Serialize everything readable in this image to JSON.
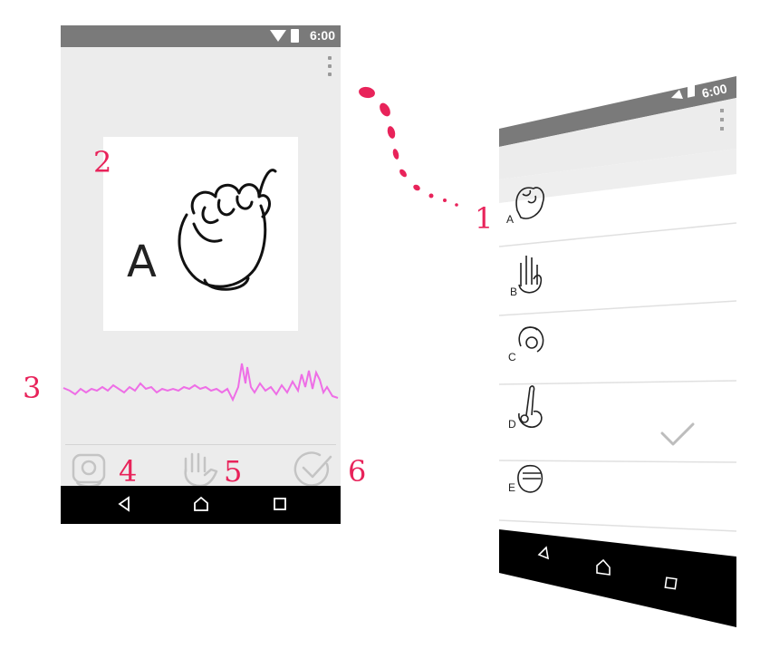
{
  "status": {
    "time": "6:00"
  },
  "detail": {
    "sign_letter": "A"
  },
  "callouts": [
    "1",
    "2",
    "3",
    "4",
    "5",
    "6"
  ],
  "list_phone": {
    "status_time": "6:00",
    "items": [
      {
        "letter": "A",
        "checked": false
      },
      {
        "letter": "B",
        "checked": false
      },
      {
        "letter": "C",
        "checked": false
      },
      {
        "letter": "D",
        "checked": true
      },
      {
        "letter": "E",
        "checked": false
      }
    ]
  },
  "colors": {
    "accent": "#e8235a",
    "waveform": "#ee6ee6",
    "status_bar": "#7a7a7a",
    "screen_bg": "#ececec",
    "nav_bar": "#000000"
  },
  "icons": {
    "action_left": "camera-icon",
    "action_middle": "hand-icon",
    "action_right": "check-circle-icon",
    "nav": [
      "back-icon",
      "home-icon",
      "recents-icon"
    ]
  }
}
